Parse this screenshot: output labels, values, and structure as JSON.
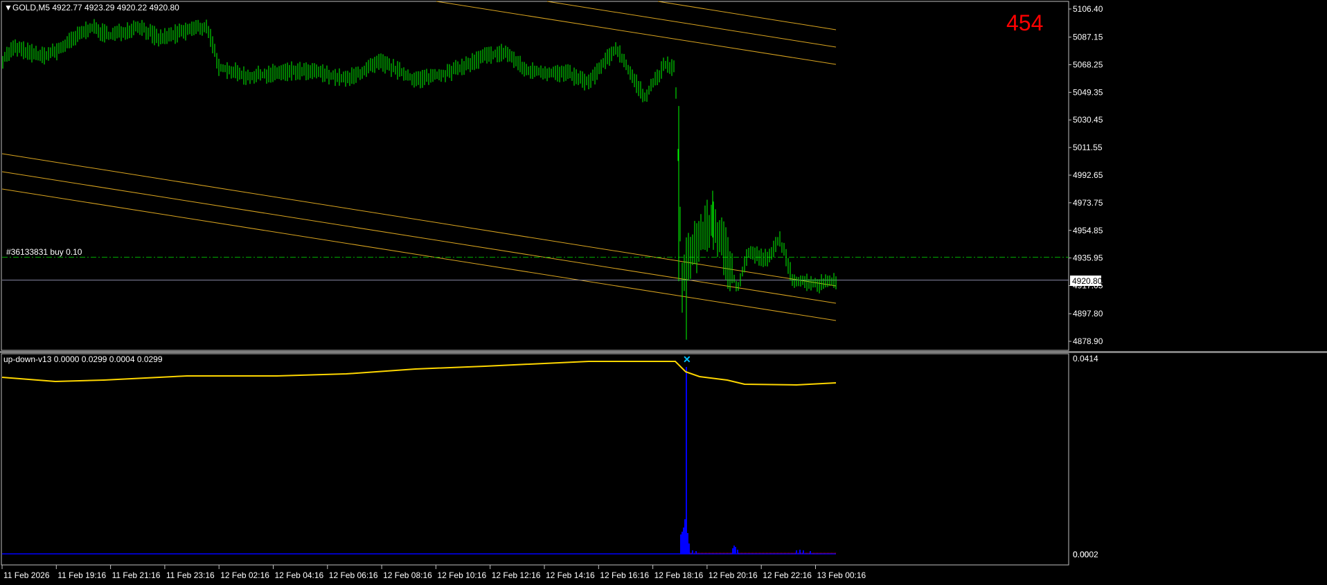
{
  "main_chart": {
    "header": "GOLD,M5  4922.77 4923.29 4920.22 4920.80",
    "counter_label": "454",
    "order_label": "#36133831 buy 0.10",
    "current_price": "4920.80",
    "price_ticks": [
      "5106.40",
      "5087.15",
      "5068.25",
      "5049.35",
      "5030.45",
      "5011.55",
      "4992.65",
      "4973.75",
      "4954.85",
      "4935.95",
      "4917.05",
      "4897.80",
      "4878.90"
    ],
    "ylim": [
      4870,
      5110
    ],
    "order_price": 4936.5,
    "last_price": 4920.8,
    "colors": {
      "bars": "#00ff00",
      "channel": "#daa520",
      "order_line": "#00aa00",
      "price_line": "#8a8aa6",
      "frame": "#c0c0c0"
    }
  },
  "indicator": {
    "header": "up-down-v13 0.0000 0.0299 0.0004 0.0299",
    "scale_top": "0.0414",
    "scale_bottom": "0.0002",
    "scale_bottom_ghost": "0.00",
    "colors": {
      "line": "#ffd700",
      "histogram": "#0000ff",
      "marker": "#00bfff",
      "baseline": "#ff0000"
    }
  },
  "time_axis": {
    "labels": [
      "11 Feb 2026",
      "11 Feb 19:16",
      "11 Feb 21:16",
      "11 Feb 23:16",
      "12 Feb 02:16",
      "12 Feb 04:16",
      "12 Feb 06:16",
      "12 Feb 08:16",
      "12 Feb 10:16",
      "12 Feb 12:16",
      "12 Feb 14:16",
      "12 Feb 16:16",
      "12 Feb 18:16",
      "12 Feb 20:16",
      "12 Feb 22:16",
      "13 Feb 00:16"
    ]
  },
  "chart_data": {
    "type": "line",
    "title": "GOLD,M5",
    "x": [
      "11 Feb 2026",
      "11 Feb 19:16",
      "11 Feb 21:16",
      "11 Feb 23:16",
      "12 Feb 02:16",
      "12 Feb 04:16",
      "12 Feb 06:16",
      "12 Feb 08:16",
      "12 Feb 10:16",
      "12 Feb 12:16",
      "12 Feb 14:16",
      "12 Feb 16:16",
      "12 Feb 18:16",
      "12 Feb 20:16",
      "12 Feb 22:16",
      "13 Feb 00:16"
    ],
    "series": [
      {
        "values": [
          5070,
          5078,
          5085,
          5081,
          5063,
          5061,
          5056,
          5066,
          5062,
          5065,
          5060,
          5075,
          4940,
          4962,
          4932,
          4920.8
        ]
      }
    ],
    "ylim": [
      4878.9,
      5106.4
    ],
    "grid": false
  }
}
